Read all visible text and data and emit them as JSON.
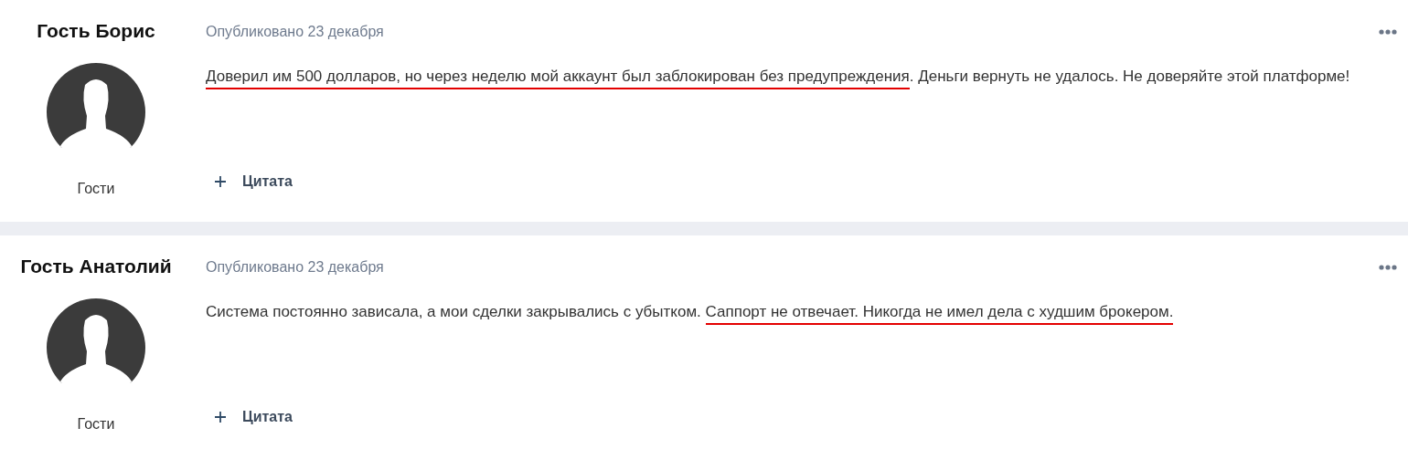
{
  "posts": [
    {
      "author": "Гость Борис",
      "group": "Гости",
      "published": "Опубликовано 23 декабря",
      "body": [
        {
          "text": "Доверил им 500 долларов, но через неделю мой аккаунт был заблокирован без предупреждения",
          "marked": true
        },
        {
          "text": ". Деньги вернуть не удалось. Не доверяйте этой платформе!",
          "marked": false
        }
      ],
      "quote_label": "Цитата"
    },
    {
      "author": "Гость Анатолий",
      "group": "Гости",
      "published": "Опубликовано 23 декабря",
      "body": [
        {
          "text": "Система постоянно зависала, а мои сделки закрывались с убытком. ",
          "marked": false
        },
        {
          "text": "Саппорт не отвечает. Никогда не имел дела с худшим брокером.",
          "marked": true
        }
      ],
      "quote_label": "Цитата"
    }
  ]
}
